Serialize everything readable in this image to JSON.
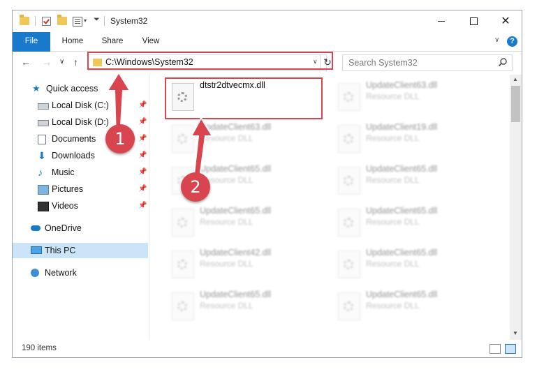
{
  "window": {
    "title": "System32",
    "controls": {
      "minimize": "minimize",
      "maximize": "maximize",
      "close": "✕"
    }
  },
  "ribbon": {
    "tabs": [
      {
        "label": "File",
        "active": true
      },
      {
        "label": "Home"
      },
      {
        "label": "Share"
      },
      {
        "label": "View"
      }
    ],
    "help": "?"
  },
  "navbar": {
    "back": "←",
    "forward": "→",
    "recent": "∨",
    "up": "↑",
    "address": "C:\\Windows\\System32",
    "refresh": "↻",
    "search_placeholder": "Search System32"
  },
  "sidebar": {
    "items": [
      {
        "label": "Quick access",
        "icon": "star-icon",
        "pinned": false
      },
      {
        "label": "Local Disk (C:)",
        "icon": "disk-icon",
        "pinned": true
      },
      {
        "label": "Local Disk (D:)",
        "icon": "disk-icon",
        "pinned": true
      },
      {
        "label": "Documents",
        "icon": "documents-icon",
        "pinned": true
      },
      {
        "label": "Downloads",
        "icon": "download-icon",
        "pinned": true
      },
      {
        "label": "Music",
        "icon": "music-icon",
        "pinned": true
      },
      {
        "label": "Pictures",
        "icon": "pictures-icon",
        "pinned": true
      },
      {
        "label": "Videos",
        "icon": "video-icon",
        "pinned": true
      },
      {
        "label": "OneDrive",
        "icon": "cloud-icon"
      },
      {
        "label": "This PC",
        "icon": "computer-icon",
        "selected": true
      },
      {
        "label": "Network",
        "icon": "network-icon"
      }
    ]
  },
  "files": {
    "left": [
      {
        "name": "dtstr2dtvecmx.dll",
        "type": "",
        "highlighted": true
      },
      {
        "name": "UpdateClient63.dll",
        "type": "Resource DLL"
      },
      {
        "name": "UpdateClient65.dll",
        "type": "Resource DLL"
      },
      {
        "name": "UpdateClient65.dll",
        "type": "Resource DLL"
      },
      {
        "name": "UpdateClient42.dll",
        "type": "Resource DLL"
      },
      {
        "name": "UpdateClient65.dll",
        "type": "Resource DLL"
      }
    ],
    "right": [
      {
        "name": "UpdateClient63.dll",
        "type": "Resource DLL"
      },
      {
        "name": "UpdateClient19.dll",
        "type": "Resource DLL"
      },
      {
        "name": "UpdateClient65.dll",
        "type": "Resource DLL"
      },
      {
        "name": "UpdateClient65.dll",
        "type": "Resource DLL"
      },
      {
        "name": "UpdateClient65.dll",
        "type": "Resource DLL"
      },
      {
        "name": "UpdateClient65.dll",
        "type": "Resource DLL"
      }
    ]
  },
  "status": {
    "count": "190 items"
  },
  "annotations": {
    "step1": "1",
    "step2": "2",
    "color": "#d9454f"
  }
}
